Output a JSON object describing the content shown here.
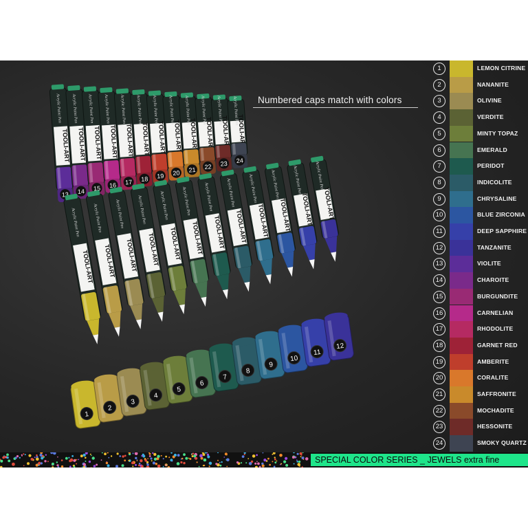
{
  "headline": "Numbered caps match with colors",
  "footer": "SPECIAL COLOR SERIES _ JEWELS extra fine",
  "brand": "TOOLI-ART",
  "pen_subtitle": "Acrylic Paint Pen",
  "colors": [
    {
      "num": "1",
      "name": "LEMON CITRINE",
      "hex": "#c9b72d"
    },
    {
      "num": "2",
      "name": "NANANITE",
      "hex": "#b99c47"
    },
    {
      "num": "3",
      "name": "OLIVINE",
      "hex": "#9b8b52"
    },
    {
      "num": "4",
      "name": "VERDITE",
      "hex": "#5b6234"
    },
    {
      "num": "5",
      "name": "MINTY TOPAZ",
      "hex": "#6d7e3a"
    },
    {
      "num": "6",
      "name": "EMERALD",
      "hex": "#467451"
    },
    {
      "num": "7",
      "name": "PERIDOT",
      "hex": "#1e5a4e"
    },
    {
      "num": "8",
      "name": "INDICOLITE",
      "hex": "#2b5b67"
    },
    {
      "num": "9",
      "name": "CHRYSALINE",
      "hex": "#2f6e8d"
    },
    {
      "num": "10",
      "name": "BLUE ZIRCONIA",
      "hex": "#2c56a1"
    },
    {
      "num": "11",
      "name": "DEEP SAPPHIRE",
      "hex": "#3640a9"
    },
    {
      "num": "12",
      "name": "TANZANITE",
      "hex": "#3a3299"
    },
    {
      "num": "13",
      "name": "VIOLITE",
      "hex": "#5c2d99"
    },
    {
      "num": "14",
      "name": "CHAROITE",
      "hex": "#7a2a8a"
    },
    {
      "num": "15",
      "name": "BURGUNDITE",
      "hex": "#992a74"
    },
    {
      "num": "16",
      "name": "CARNELIAN",
      "hex": "#b52a8a"
    },
    {
      "num": "17",
      "name": "RHODOLITE",
      "hex": "#b52a62"
    },
    {
      "num": "18",
      "name": "GARNET RED",
      "hex": "#9e2237"
    },
    {
      "num": "19",
      "name": "AMBERITE",
      "hex": "#bf3e2c"
    },
    {
      "num": "20",
      "name": "CORALITE",
      "hex": "#d9782b"
    },
    {
      "num": "21",
      "name": "SAFFRONITE",
      "hex": "#c98a2b"
    },
    {
      "num": "22",
      "name": "MOCHADITE",
      "hex": "#8a4a2a"
    },
    {
      "num": "23",
      "name": "HESSONITE",
      "hex": "#6e2b28"
    },
    {
      "num": "24",
      "name": "SMOKY QUARTZ",
      "hex": "#3e4452"
    }
  ]
}
